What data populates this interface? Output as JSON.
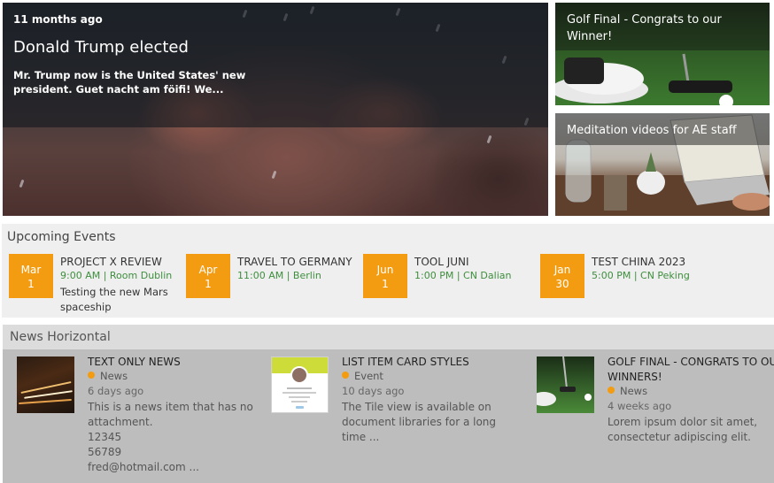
{
  "hero": {
    "age": "11 months ago",
    "title": "Donald Trump elected",
    "body": "Mr. Trump now is the United States' new president. Guet nacht am föifi! We..."
  },
  "tiles": [
    {
      "caption": "Golf Final - Congrats to our Winner!"
    },
    {
      "caption": "Meditation videos for AE staff"
    }
  ],
  "events": {
    "title": "Upcoming Events",
    "items": [
      {
        "month": "Mar",
        "day": "1",
        "title": "PROJECT X REVIEW",
        "meta": "9:00 AM | Room Dublin",
        "desc": "Testing the new Mars spaceship"
      },
      {
        "month": "Apr",
        "day": "1",
        "title": "TRAVEL TO GERMANY",
        "meta": "11:00 AM | Berlin",
        "desc": ""
      },
      {
        "month": "Jun",
        "day": "1",
        "title": "TOOL JUNI",
        "meta": "1:00 PM | CN Dalian",
        "desc": ""
      },
      {
        "month": "Jan",
        "day": "30",
        "title": "TEST CHINA 2023",
        "meta": "5:00 PM | CN Peking",
        "desc": ""
      }
    ]
  },
  "news": {
    "title": "News Horizontal",
    "items": [
      {
        "title": "TEXT ONLY NEWS",
        "category": "News",
        "age": "6 days ago",
        "desc": "This is a news item that has no attachment.\n12345\n56789\nfred@hotmail.com ..."
      },
      {
        "title": "LIST ITEM CARD STYLES",
        "category": "Event",
        "age": "10 days ago",
        "desc": "The Tile view is available on document libraries for a long time ..."
      },
      {
        "title": "GOLF FINAL - CONGRATS TO OUR WINNERS!",
        "category": "News",
        "age": "4 weeks ago",
        "desc": "Lorem ipsum dolor sit amet, consectetur adipiscing elit."
      }
    ]
  },
  "colors": {
    "accent": "#f39c12",
    "event_meta": "#3e8e3e"
  }
}
